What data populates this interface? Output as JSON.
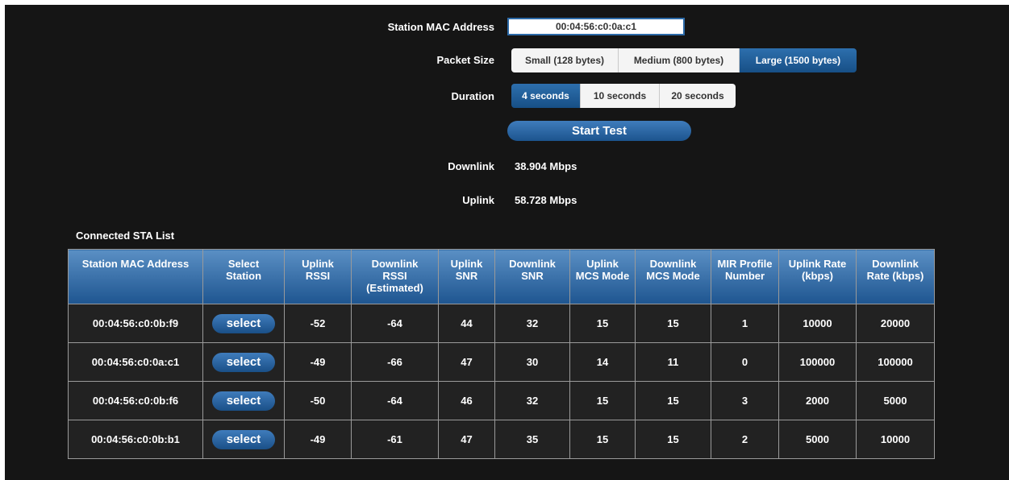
{
  "form": {
    "mac_label": "Station MAC Address",
    "mac_value": "00:04:56:c0:0a:c1",
    "packet_size_label": "Packet Size",
    "packet_sizes": [
      "Small (128 bytes)",
      "Medium (800 bytes)",
      "Large (1500 bytes)"
    ],
    "packet_size_selected": "Large (1500 bytes)",
    "duration_label": "Duration",
    "durations": [
      "4 seconds",
      "10 seconds",
      "20 seconds"
    ],
    "duration_selected": "4 seconds",
    "start_label": "Start Test"
  },
  "results": {
    "downlink_label": "Downlink",
    "downlink_value": "38.904 Mbps",
    "uplink_label": "Uplink",
    "uplink_value": "58.728 Mbps"
  },
  "sta_list": {
    "title": "Connected STA List",
    "headers": [
      [
        "Station MAC Address"
      ],
      [
        "Select",
        "Station"
      ],
      [
        "Uplink",
        "RSSI"
      ],
      [
        "Downlink",
        "RSSI",
        "(Estimated)"
      ],
      [
        "Uplink",
        "SNR"
      ],
      [
        "Downlink",
        "SNR"
      ],
      [
        "Uplink",
        "MCS Mode"
      ],
      [
        "Downlink",
        "MCS Mode"
      ],
      [
        "MIR Profile",
        "Number"
      ],
      [
        "Uplink Rate",
        "(kbps)"
      ],
      [
        "Downlink",
        "Rate (kbps)"
      ]
    ],
    "select_label": "select",
    "rows": [
      {
        "mac": "00:04:56:c0:0b:f9",
        "uplink_rssi": "-52",
        "downlink_rssi": "-64",
        "uplink_snr": "44",
        "downlink_snr": "32",
        "uplink_mcs": "15",
        "downlink_mcs": "15",
        "mir_profile": "1",
        "uplink_rate": "10000",
        "downlink_rate": "20000"
      },
      {
        "mac": "00:04:56:c0:0a:c1",
        "uplink_rssi": "-49",
        "downlink_rssi": "-66",
        "uplink_snr": "47",
        "downlink_snr": "30",
        "uplink_mcs": "14",
        "downlink_mcs": "11",
        "mir_profile": "0",
        "uplink_rate": "100000",
        "downlink_rate": "100000"
      },
      {
        "mac": "00:04:56:c0:0b:f6",
        "uplink_rssi": "-50",
        "downlink_rssi": "-64",
        "uplink_snr": "46",
        "downlink_snr": "32",
        "uplink_mcs": "15",
        "downlink_mcs": "15",
        "mir_profile": "3",
        "uplink_rate": "2000",
        "downlink_rate": "5000"
      },
      {
        "mac": "00:04:56:c0:0b:b1",
        "uplink_rssi": "-49",
        "downlink_rssi": "-61",
        "uplink_snr": "47",
        "downlink_snr": "35",
        "uplink_mcs": "15",
        "downlink_mcs": "15",
        "mir_profile": "2",
        "uplink_rate": "5000",
        "downlink_rate": "10000"
      }
    ]
  },
  "colors": {
    "background": "#151515",
    "accent": "#1f5a96",
    "cell": "#222222"
  }
}
